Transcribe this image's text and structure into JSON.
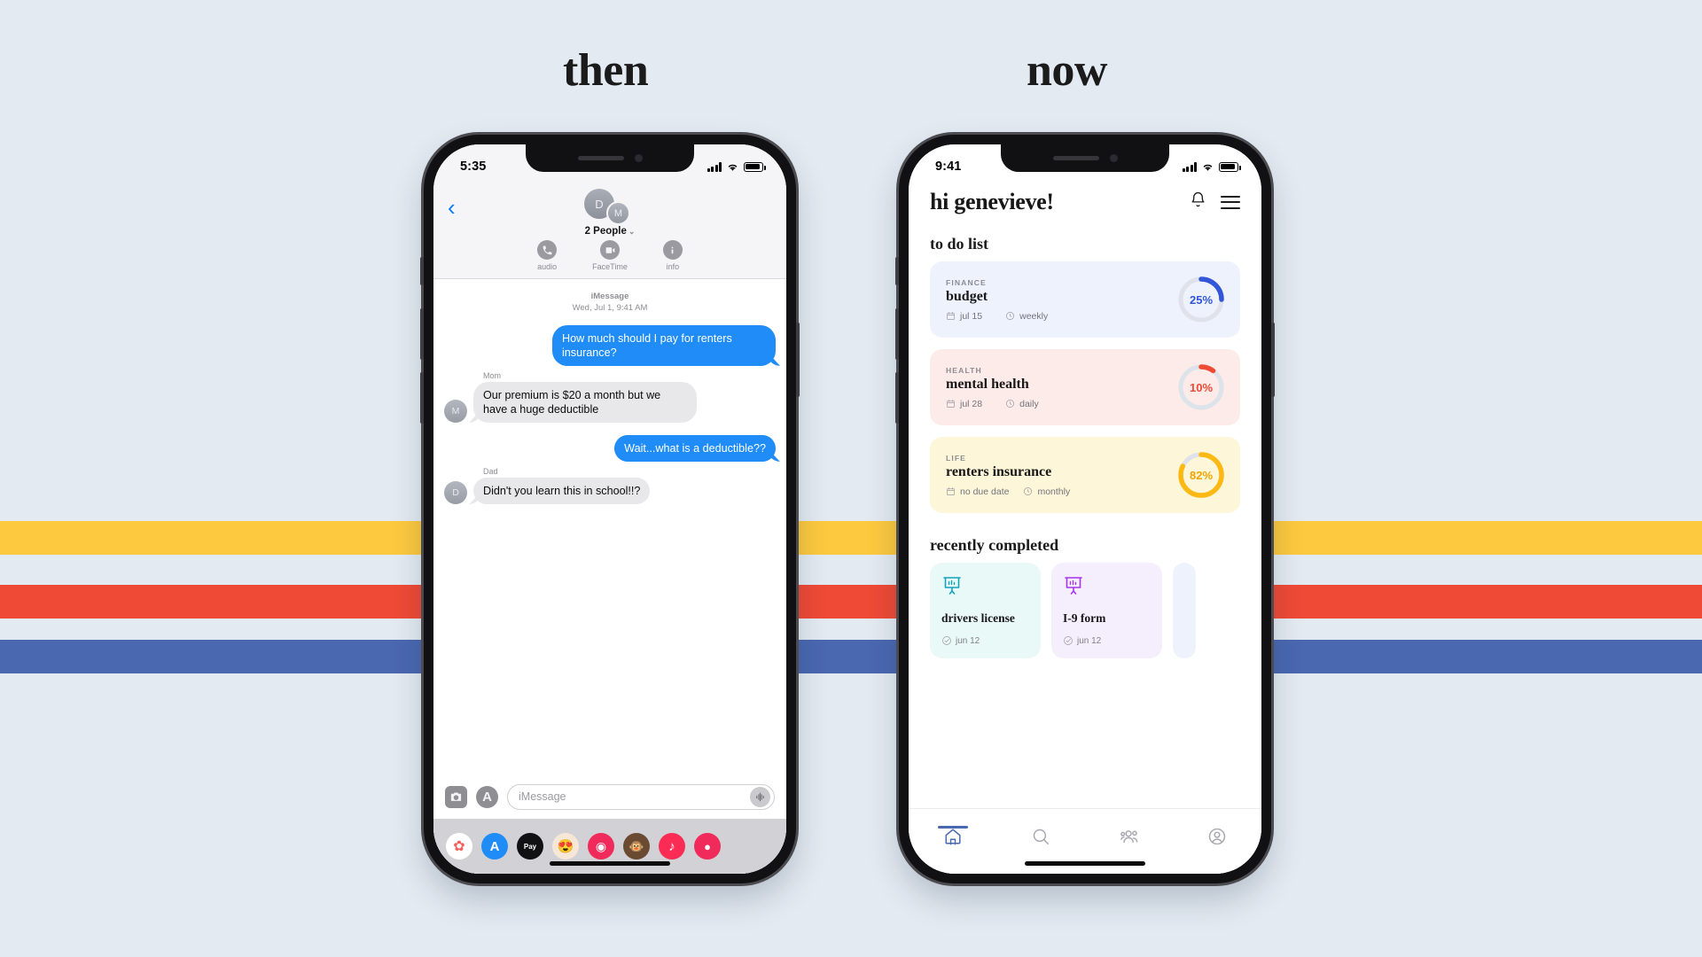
{
  "captions": {
    "then": "then",
    "now": "now"
  },
  "palette": {
    "background": "#e3eaf2",
    "stripe_yellow": "#fcc93f",
    "stripe_red": "#ef4a36",
    "stripe_blue": "#4a68b0",
    "imessage_blue": "#1f8cf8",
    "imessage_gray": "#e8e8ea"
  },
  "phone_left": {
    "status": {
      "time": "5:35",
      "signal": "cellular-bars",
      "wifi": "wifi-icon",
      "battery": "battery-icon"
    },
    "header": {
      "back": "‹",
      "avatars": [
        {
          "initial": "D"
        },
        {
          "initial": "M"
        }
      ],
      "people_label": "2 People",
      "actions": [
        {
          "icon": "phone-icon",
          "label": "audio"
        },
        {
          "icon": "video-icon",
          "label": "FaceTime"
        },
        {
          "icon": "info-icon",
          "label": "info"
        }
      ]
    },
    "conversation": {
      "service": "iMessage",
      "timestamp": "Wed, Jul 1, 9:41 AM",
      "messages": [
        {
          "side": "out",
          "sender": "",
          "avatar": "",
          "text": "How much should I pay for renters insurance?"
        },
        {
          "side": "in",
          "sender": "Mom",
          "avatar": "M",
          "text": "Our premium is $20 a month but we have a huge deductible"
        },
        {
          "side": "out",
          "sender": "",
          "avatar": "",
          "text": "Wait...what is a deductible??"
        },
        {
          "side": "in",
          "sender": "Dad",
          "avatar": "D",
          "text": "Didn't you learn this in school!!?"
        }
      ]
    },
    "footer": {
      "camera_icon": "camera-icon",
      "appstore_icon": "app-store-icon",
      "input_placeholder": "iMessage",
      "mic_icon": "audio-waveform-icon",
      "drawer_apps": [
        {
          "name": "photos-app-icon",
          "bg": "#ffffff",
          "glyph": "✿",
          "color": "#f25f5c"
        },
        {
          "name": "app-store-app-icon",
          "bg": "#1f8cf8",
          "glyph": "A",
          "color": "#ffffff"
        },
        {
          "name": "apple-pay-app-icon",
          "bg": "#111114",
          "glyph": "Pay",
          "color": "#ffffff"
        },
        {
          "name": "memoji-app-icon",
          "bg": "#f7e7d6",
          "glyph": "😍",
          "color": "#8a5a2b"
        },
        {
          "name": "image-search-app-icon",
          "bg": "#f02a5a",
          "glyph": "◉",
          "color": "#ffffff"
        },
        {
          "name": "animoji-app-icon",
          "bg": "#6b4a32",
          "glyph": "🐵",
          "color": "#ffffff"
        },
        {
          "name": "music-app-icon",
          "bg": "#fa2c55",
          "glyph": "♪",
          "color": "#ffffff"
        },
        {
          "name": "more-app-icon",
          "bg": "#f02a5a",
          "glyph": "●",
          "color": "#ffffff"
        }
      ]
    }
  },
  "phone_right": {
    "status": {
      "time": "9:41",
      "signal": "cellular-bars",
      "wifi": "wifi-icon",
      "battery": "battery-icon"
    },
    "header": {
      "greeting": "hi genevieve!",
      "bell_icon": "bell-icon",
      "menu_icon": "hamburger-menu-icon"
    },
    "todo": {
      "title": "to do list",
      "items": [
        {
          "category": "FINANCE",
          "name": "budget",
          "due_date": "jul 15",
          "frequency": "weekly",
          "percent": 25,
          "percent_label": "25%",
          "card_bg": "#eef2fd",
          "accent": "#3355d8",
          "track": "#dfe2ea"
        },
        {
          "category": "HEALTH",
          "name": "mental health",
          "due_date": "jul 28",
          "frequency": "daily",
          "percent": 10,
          "percent_label": "10%",
          "card_bg": "#fcebe8",
          "accent": "#ef4a36",
          "track": "#dde3ea"
        },
        {
          "category": "LIFE",
          "name": "renters insurance",
          "due_date": "no due date",
          "frequency": "monthly",
          "percent": 82,
          "percent_label": "82%",
          "card_bg": "#fdf6d8",
          "accent": "#fcb813",
          "track": "#dfe2ea"
        }
      ]
    },
    "completed": {
      "title": "recently completed",
      "items": [
        {
          "icon": "presentation-chart-icon",
          "name": "drivers license",
          "date": "jun 12",
          "card_bg": "#e9f9f7",
          "accent": "#12a4bd"
        },
        {
          "icon": "presentation-chart-icon",
          "name": "I-9 form",
          "date": "jun 12",
          "card_bg": "#f5eefc",
          "accent": "#a635ef"
        },
        {
          "icon": "presentation-chart-icon",
          "name": "",
          "date": "",
          "card_bg": "#eef2fd",
          "accent": "#3355d8"
        }
      ]
    },
    "tabbar": [
      {
        "icon": "home-icon",
        "active": true
      },
      {
        "icon": "search-icon",
        "active": false
      },
      {
        "icon": "people-icon",
        "active": false
      },
      {
        "icon": "profile-icon",
        "active": false
      }
    ]
  }
}
